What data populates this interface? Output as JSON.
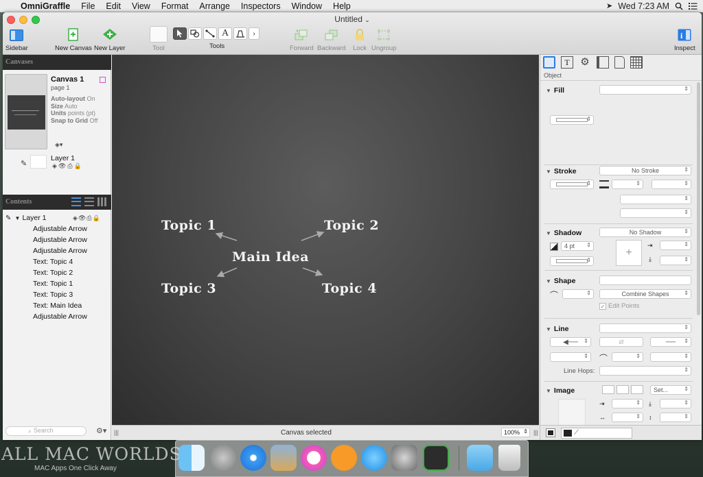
{
  "menubar": {
    "app_name": "OmniGraffle",
    "items": [
      "File",
      "Edit",
      "View",
      "Format",
      "Arrange",
      "Inspectors",
      "Window",
      "Help"
    ],
    "clock": "Wed 7:23 AM"
  },
  "window": {
    "title": "Untitled",
    "toolbar": {
      "sidebar": "Sidebar",
      "new_canvas": "New Canvas",
      "new_layer": "New Layer",
      "tool": "Tool",
      "tools": "Tools",
      "text_tool": "A",
      "forward": "Forward",
      "backward": "Backward",
      "lock": "Lock",
      "ungroup": "Ungroup",
      "inspect": "Inspect"
    }
  },
  "sidebar": {
    "canvases_header": "Canvases",
    "canvas": {
      "name": "Canvas 1",
      "page": "page 1",
      "props": [
        {
          "label": "Auto-layout",
          "value": "On"
        },
        {
          "label": "Size",
          "value": "Auto"
        },
        {
          "label": "Units",
          "value": "points (pt)"
        },
        {
          "label": "Snap to Grid",
          "value": "Off"
        }
      ]
    },
    "layer_name": "Layer 1",
    "contents_header": "Contents",
    "outline_layer": "Layer 1",
    "outline_items": [
      "Adjustable Arrow",
      "Adjustable Arrow",
      "Adjustable Arrow",
      "Text: Topic 4",
      "Text: Topic 2",
      "Text: Topic 1",
      "Text: Topic 3",
      "Text: Main Idea",
      "Adjustable Arrow"
    ],
    "search_placeholder": "Search"
  },
  "canvas": {
    "main_idea": "Main Idea",
    "topic1": "Topic 1",
    "topic2": "Topic 2",
    "topic3": "Topic 3",
    "topic4": "Topic 4"
  },
  "statusbar": {
    "status": "Canvas selected",
    "zoom": "100%"
  },
  "inspector": {
    "tab_label": "Object",
    "fill": "Fill",
    "stroke": "Stroke",
    "no_stroke": "No Stroke",
    "shadow": "Shadow",
    "no_shadow": "No Shadow",
    "shadow_size": "4 pt",
    "shape": "Shape",
    "combine_shapes": "Combine Shapes",
    "edit_points": "Edit Points",
    "line": "Line",
    "line_hops": "Line Hops:",
    "image": "Image",
    "image_set": "Set..."
  },
  "watermark": {
    "title": "ALL MAC WORLDS",
    "subtitle": "MAC Apps One Click Away"
  },
  "colors": {
    "canvas_bg": "#444444",
    "sidebar_header": "#2c2c2c",
    "accent_blue": "#2a7be4",
    "green_icon": "#3cb043"
  }
}
